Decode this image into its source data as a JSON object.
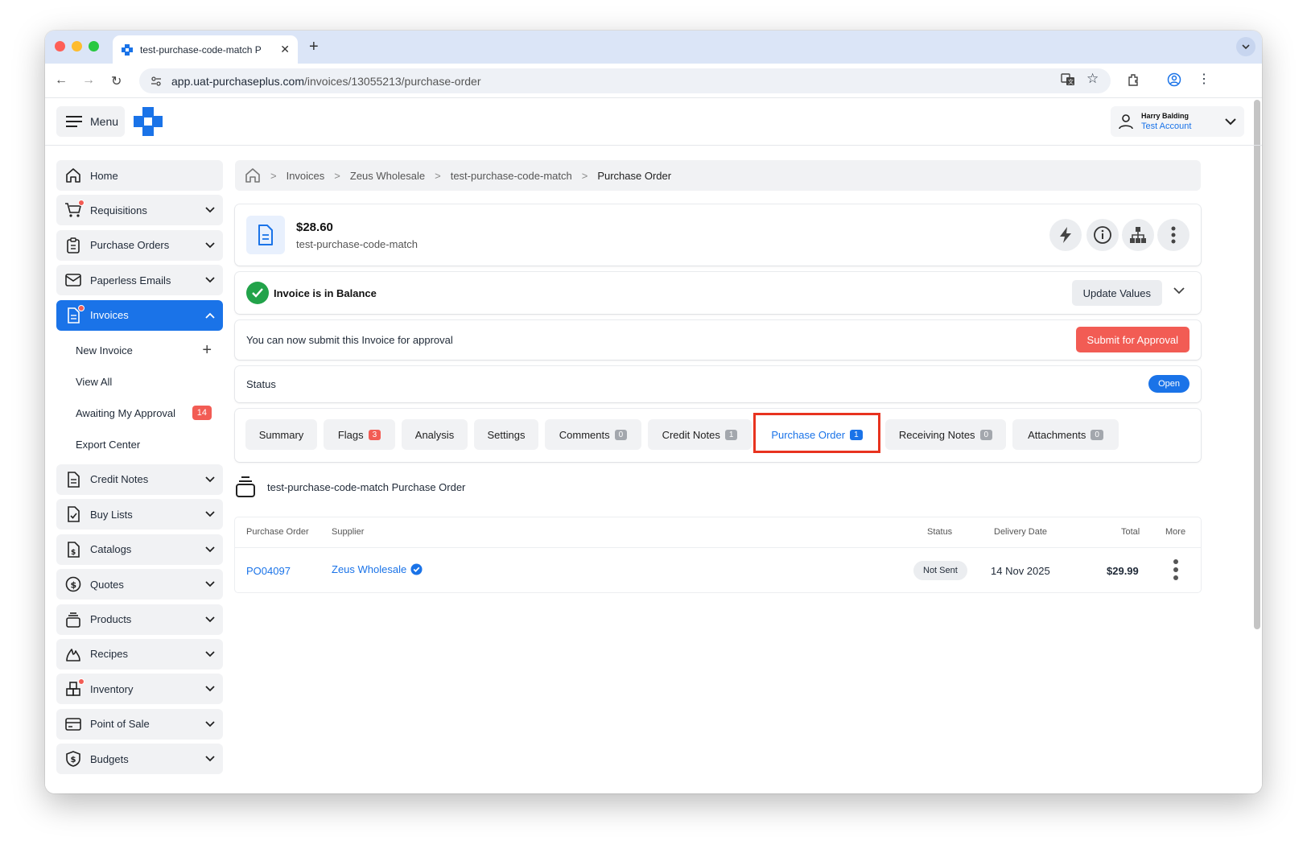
{
  "browser": {
    "tab_title": "test-purchase-code-match P",
    "url_host": "app.uat-purchaseplus.com",
    "url_path": "/invoices/13055213/purchase-order"
  },
  "header": {
    "menu_label": "Menu",
    "user_name": "Harry Balding",
    "account_name": "Test Account"
  },
  "sidebar": {
    "items": [
      {
        "label": "Home",
        "icon": "home-icon"
      },
      {
        "label": "Requisitions",
        "icon": "cart-icon"
      },
      {
        "label": "Purchase Orders",
        "icon": "clipboard-icon"
      },
      {
        "label": "Paperless Emails",
        "icon": "mail-icon"
      },
      {
        "label": "Invoices",
        "icon": "document-icon"
      }
    ],
    "invoice_sub": [
      {
        "label": "New Invoice"
      },
      {
        "label": "View All"
      },
      {
        "label": "Awaiting My Approval",
        "badge": "14"
      },
      {
        "label": "Export Center"
      }
    ],
    "items_after": [
      {
        "label": "Credit Notes",
        "icon": "document-icon"
      },
      {
        "label": "Buy Lists",
        "icon": "checklist-icon"
      },
      {
        "label": "Catalogs",
        "icon": "catalog-icon"
      },
      {
        "label": "Quotes",
        "icon": "dollar-circle-icon"
      },
      {
        "label": "Products",
        "icon": "stack-icon"
      },
      {
        "label": "Recipes",
        "icon": "flame-icon"
      },
      {
        "label": "Inventory",
        "icon": "boxes-icon"
      },
      {
        "label": "Point of Sale",
        "icon": "card-icon"
      },
      {
        "label": "Budgets",
        "icon": "shield-dollar-icon"
      }
    ]
  },
  "breadcrumb": {
    "items": [
      "Invoices",
      "Zeus Wholesale",
      "test-purchase-code-match"
    ],
    "current": "Purchase Order"
  },
  "invoice": {
    "amount": "$28.60",
    "title": "test-purchase-code-match",
    "balance_text": "Invoice is in Balance",
    "update_label": "Update Values",
    "submit_text": "You can now submit this Invoice for approval",
    "submit_label": "Submit for Approval",
    "status_label": "Status",
    "status_value": "Open"
  },
  "tabs": [
    {
      "label": "Summary"
    },
    {
      "label": "Flags",
      "badge": "3"
    },
    {
      "label": "Analysis"
    },
    {
      "label": "Settings"
    },
    {
      "label": "Comments",
      "badge": "0"
    },
    {
      "label": "Credit Notes",
      "badge": "1"
    },
    {
      "label": "Purchase Order",
      "badge": "1"
    },
    {
      "label": "Receiving Notes",
      "badge": "0"
    },
    {
      "label": "Attachments",
      "badge": "0"
    }
  ],
  "po_section": {
    "title": "test-purchase-code-match Purchase Order",
    "columns": [
      "Purchase Order",
      "Supplier",
      "Status",
      "Delivery Date",
      "Total",
      "More"
    ],
    "rows": [
      {
        "po": "PO04097",
        "supplier": "Zeus Wholesale",
        "status": "Not Sent",
        "delivery": "14 Nov 2025",
        "total": "$29.99"
      }
    ]
  },
  "colors": {
    "accent": "#1a73e8",
    "danger": "#f25c54",
    "success": "#22a34a"
  }
}
